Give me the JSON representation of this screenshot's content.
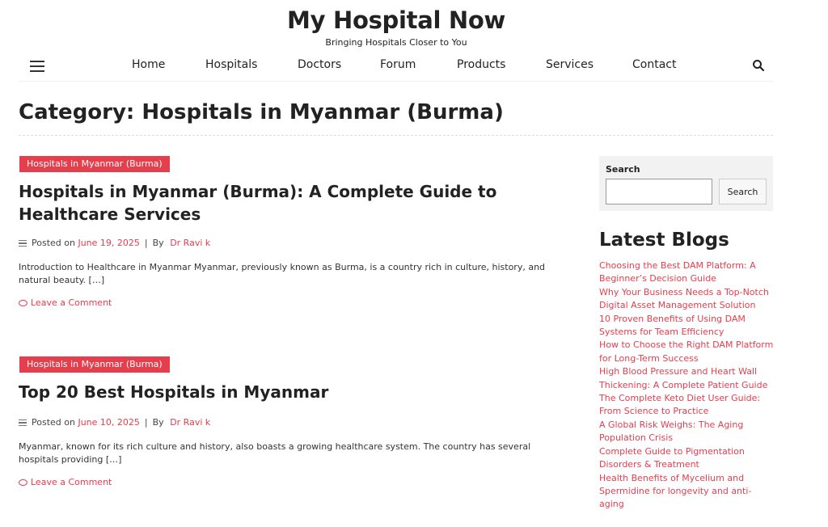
{
  "site": {
    "title": "My Hospital Now",
    "tagline": "Bringing Hospitals Closer to You"
  },
  "nav": {
    "menu_icon": "hamburger-menu-icon",
    "items": [
      "Home",
      "Hospitals",
      "Doctors",
      "Forum",
      "Products",
      "Services",
      "Contact"
    ],
    "search_icon": "search-icon"
  },
  "page": {
    "title": "Category: Hospitals in Myanmar (Burma)"
  },
  "posts": [
    {
      "category": "Hospitals in Myanmar (Burma)",
      "title": "Hospitals in Myanmar (Burma): A Complete Guide to Healthcare Services",
      "posted_on_label": "Posted on",
      "date": "June 19, 2025",
      "separator": "|",
      "by_label": "By",
      "author": "Dr Ravi k",
      "excerpt": "Introduction to Healthcare in Myanmar Myanmar, previously known as Burma, is a country rich in culture, history, and natural beauty. […]",
      "comment_label": "Leave a Comment"
    },
    {
      "category": "Hospitals in Myanmar (Burma)",
      "title": "Top 20 Best Hospitals in Myanmar",
      "posted_on_label": "Posted on",
      "date": "June 10, 2025",
      "separator": "|",
      "by_label": "By",
      "author": "Dr Ravi k",
      "excerpt": "Myanmar, known for its rich culture and history, also boasts a growing healthcare system. The country has several hospitals providing […]",
      "comment_label": "Leave a Comment"
    }
  ],
  "sidebar": {
    "search": {
      "label": "Search",
      "placeholder": "",
      "value": "",
      "button": "Search"
    },
    "latest": {
      "heading": "Latest Blogs",
      "items": [
        "Choosing the Best DAM Platform: A Beginner’s Decision Guide",
        "Why Your Business Needs a Top-Notch Digital Asset Management Solution",
        "10 Proven Benefits of Using DAM Systems for Team Efficiency",
        "How to Choose the Right DAM Platform for Long-Term Success",
        "High Blood Pressure and Heart Wall Thickening: A Complete Patient Guide",
        "The Complete Keto Diet User Guide: From Science to Practice",
        "A Global Risk Weighs: The Aging Population Crisis",
        "Complete Guide to Pigmentation Disorders & Treatment",
        "Health Benefits of Mycelium and Spermidine for longevity and anti-aging"
      ]
    }
  },
  "colors": {
    "accent": "#e53e4d",
    "text": "#222222",
    "widget_bg": "#f2f2f2"
  }
}
